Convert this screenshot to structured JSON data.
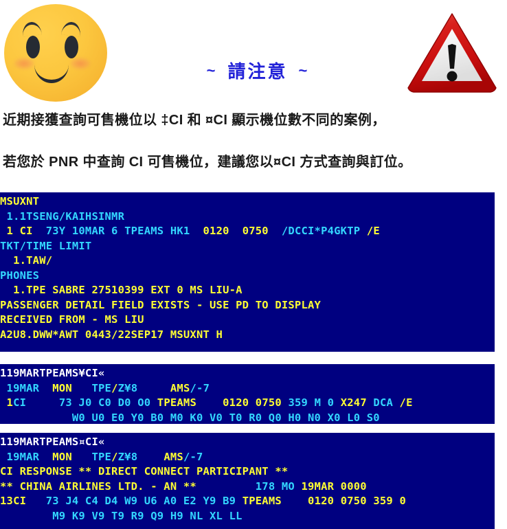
{
  "header": {
    "title_tilde_left": "~",
    "title_text": "請注意",
    "title_tilde_right": "~",
    "title_color": "#2222d8",
    "smiley_icon": "smiley-face-icon",
    "warning_icon": "warning-triangle-icon"
  },
  "notice": {
    "line1": "近期接獲查詢可售機位以 ‡CI 和 ¤CI 顯示機位數不同的案例，",
    "line2": "若您於 PNR 中查詢 CI 可售機位，建議您以¤CI 方式查詢與訂位。"
  },
  "terminal": {
    "background_color": "#000080",
    "yellow": "#ffff33",
    "cyan": "#33d6ff",
    "white": "#ffffff",
    "block1": {
      "name": "pnr-display",
      "lines": [
        [
          {
            "t": "MSUXNT",
            "c": "yellow"
          }
        ],
        [
          {
            "t": " 1.1TSENG/KAIHSINMR",
            "c": "cyan"
          }
        ],
        [
          {
            "t": " 1 CI",
            "c": "yellow"
          },
          {
            "t": "  73Y 10MAR 6 TPEAMS HK1",
            "c": "cyan"
          },
          {
            "t": "  0120  0750",
            "c": "yellow"
          },
          {
            "t": "  /DCCI*P4GKTP",
            "c": "cyan"
          },
          {
            "t": " /E",
            "c": "yellow"
          }
        ],
        [
          {
            "t": "TKT/TIME LIMIT",
            "c": "cyan"
          }
        ],
        [
          {
            "t": "  1.TAW/",
            "c": "yellow"
          }
        ],
        [
          {
            "t": "PHONES",
            "c": "cyan"
          }
        ],
        [
          {
            "t": "  1.TPE SABRE 27510399 EXT 0 MS LIU-A",
            "c": "yellow"
          }
        ],
        [
          {
            "t": "PASSENGER DETAIL FIELD EXISTS - USE PD TO DISPLAY",
            "c": "yellow"
          }
        ],
        [
          {
            "t": "RECEIVED FROM - MS LIU",
            "c": "yellow"
          }
        ],
        [
          {
            "t": "A2U8.DWW*AWT 0443/22SEP17 MSUXNT H",
            "c": "yellow"
          }
        ]
      ]
    },
    "block2": {
      "name": "availability-yen-ci",
      "lines": [
        [
          {
            "t": "119MARTPEAMS¥CI«",
            "c": "white"
          }
        ],
        [
          {
            "t": " 19MAR",
            "c": "cyan"
          },
          {
            "t": "  MON",
            "c": "yellow"
          },
          {
            "t": "   TPE",
            "c": "cyan"
          },
          {
            "t": "/",
            "c": "yellow"
          },
          {
            "t": "Z¥8",
            "c": "cyan"
          },
          {
            "t": "     AMS",
            "c": "yellow"
          },
          {
            "t": "/-7",
            "c": "cyan"
          }
        ],
        [
          {
            "t": " 1",
            "c": "yellow"
          },
          {
            "t": "CI",
            "c": "cyan"
          },
          {
            "t": "     73 J0 C0 D0 O0 ",
            "c": "cyan"
          },
          {
            "t": "TPEAMS",
            "c": "yellow"
          },
          {
            "t": "    ",
            "c": "cyan"
          },
          {
            "t": "0120 0750",
            "c": "yellow"
          },
          {
            "t": " 359 M 0 ",
            "c": "cyan"
          },
          {
            "t": "X247",
            "c": "yellow"
          },
          {
            "t": " DCA",
            "c": "cyan"
          },
          {
            "t": " /E",
            "c": "yellow"
          }
        ],
        [
          {
            "t": "           W0 U0 E0 Y0 B0 M0 K0 V0 T0 R0 Q0 H0 N0 X0 L0 S0",
            "c": "cyan"
          }
        ]
      ]
    },
    "block3": {
      "name": "availability-currency-ci",
      "lines": [
        [
          {
            "t": "119MARTPEAMS¤CI«",
            "c": "white"
          }
        ],
        [
          {
            "t": " 19MAR",
            "c": "cyan"
          },
          {
            "t": "  MON",
            "c": "yellow"
          },
          {
            "t": "   TPE",
            "c": "cyan"
          },
          {
            "t": "/",
            "c": "yellow"
          },
          {
            "t": "Z¥8",
            "c": "cyan"
          },
          {
            "t": "    AMS",
            "c": "yellow"
          },
          {
            "t": "/-7",
            "c": "cyan"
          }
        ],
        [
          {
            "t": "CI RESPONSE ** DIRECT CONNECT PARTICIPANT **",
            "c": "yellow"
          }
        ],
        [
          {
            "t": "** CHINA AIRLINES LTD. - AN **",
            "c": "yellow"
          },
          {
            "t": "         178 MO ",
            "c": "cyan"
          },
          {
            "t": "19MAR 0000",
            "c": "yellow"
          }
        ],
        [
          {
            "t": "13CI",
            "c": "yellow"
          },
          {
            "t": "   73 J4 C4 D4 W9 U6 A0 E2 Y9 B9 ",
            "c": "cyan"
          },
          {
            "t": "TPEAMS",
            "c": "yellow"
          },
          {
            "t": "    ",
            "c": "cyan"
          },
          {
            "t": "0120 0750 359 0",
            "c": "yellow"
          }
        ],
        [
          {
            "t": "        M9 K9 V9 T9 R9 Q9 H9 NL XL LL",
            "c": "cyan"
          }
        ]
      ]
    }
  }
}
